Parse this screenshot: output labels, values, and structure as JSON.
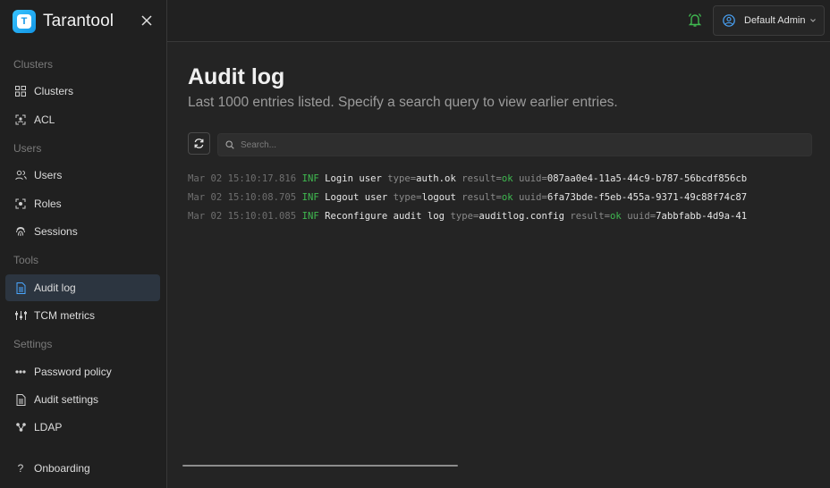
{
  "app": {
    "name": "Tarantool",
    "logo_letter": "T"
  },
  "sidebar": {
    "sections": {
      "clusters": "Clusters",
      "users": "Users",
      "tools": "Tools",
      "settings": "Settings"
    },
    "items": {
      "clusters": "Clusters",
      "acl": "ACL",
      "users": "Users",
      "roles": "Roles",
      "sessions": "Sessions",
      "audit_log": "Audit log",
      "tcm_metrics": "TCM metrics",
      "password_policy": "Password policy",
      "audit_settings": "Audit settings",
      "ldap": "LDAP",
      "onboarding": "Onboarding"
    },
    "active": "audit_log",
    "accent": "#4aa7ff"
  },
  "header": {
    "user": "Default Admin",
    "bell_color": "#3fb950"
  },
  "main": {
    "title": "Audit log",
    "subtitle": "Last 1000 entries listed. Specify a search query to view earlier entries.",
    "search_placeholder": "Search...",
    "log": [
      {
        "ts": "Mar 02 15:10:17.816",
        "level": "INF",
        "msg": "Login user",
        "type": "auth.ok",
        "result": "ok",
        "uuid": "087aa0e4-11a5-44c9-b787-56bcdf856cb"
      },
      {
        "ts": "Mar 02 15:10:08.705",
        "level": "INF",
        "msg": "Logout user",
        "type": "logout",
        "result": "ok",
        "uuid": "6fa73bde-f5eb-455a-9371-49c88f74c87"
      },
      {
        "ts": "Mar 02 15:10:01.085",
        "level": "INF",
        "msg": "Reconfigure audit log",
        "type": "auditlog.config",
        "result": "ok",
        "uuid": "7abbfabb-4d9a-41"
      }
    ],
    "labels": {
      "type": "type=",
      "result": "result=",
      "uuid": "uuid="
    }
  }
}
